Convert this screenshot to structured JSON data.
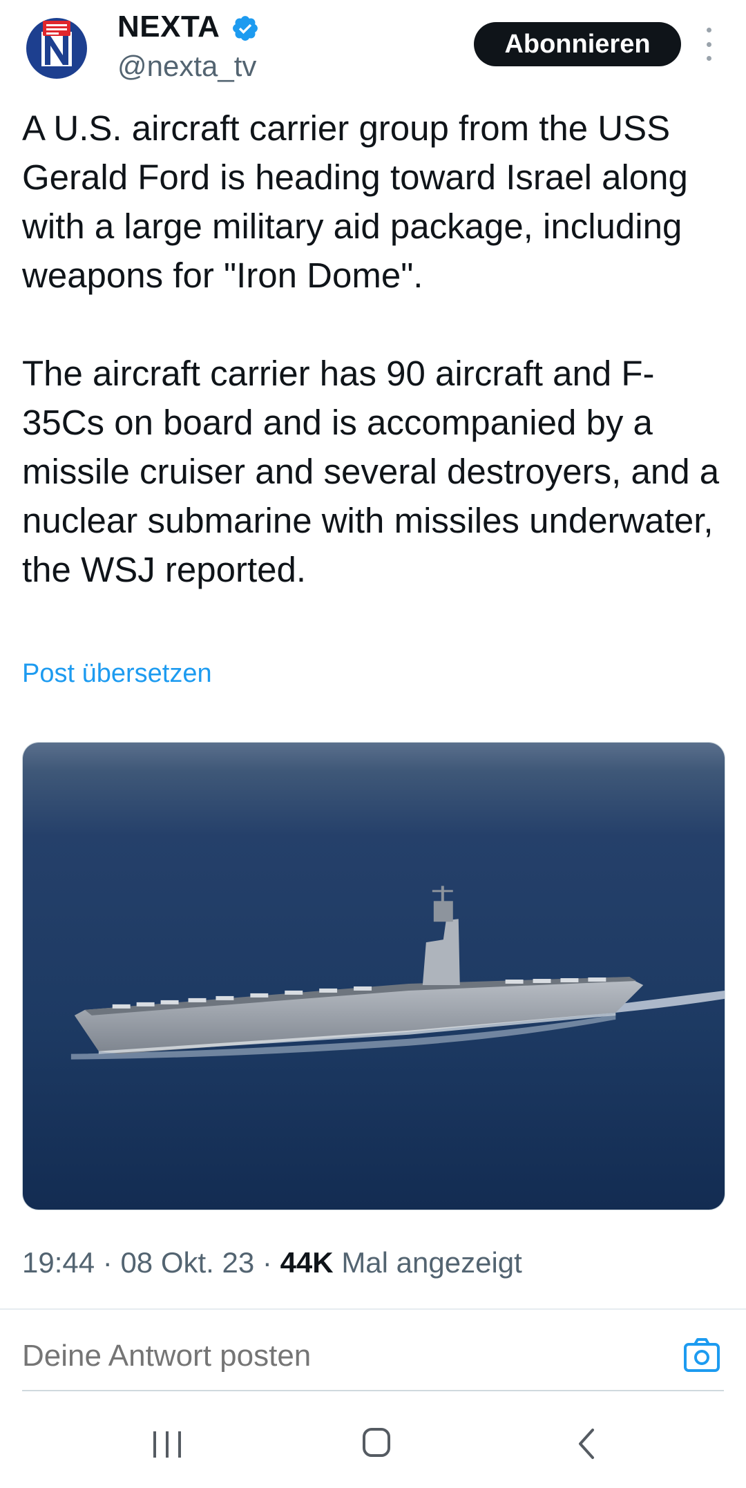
{
  "account": {
    "display_name": "NEXTA",
    "handle": "@nexta_tv",
    "verified": true,
    "avatar_icon": "nexta-logo-icon"
  },
  "header": {
    "subscribe_label": "Abonnieren",
    "more_icon": "vertical-dots-icon"
  },
  "tweet": {
    "paragraphs": [
      "A U.S. aircraft carrier group from the USS Gerald Ford is heading toward Israel along with a large military aid package, including weapons for \"Iron Dome\".",
      "The aircraft carrier has 90 aircraft and F-35Cs on board and is accompanied by a missile cruiser and several destroyers, and a nuclear submarine with missiles underwater, the WSJ reported."
    ],
    "translate_label": "Post übersetzen",
    "media_icon": "aircraft-carrier-photo"
  },
  "meta": {
    "time": "19:44",
    "separator": "·",
    "date": "08 Okt. 23",
    "views_count": "44K",
    "views_label": "Mal angezeigt"
  },
  "reply": {
    "placeholder": "Deine Antwort posten",
    "camera_icon": "camera-icon"
  },
  "navbar": {
    "recents_icon": "recents-icon",
    "home_icon": "home-icon",
    "back_icon": "back-icon"
  },
  "colors": {
    "text": "#0f1419",
    "secondary": "#536471",
    "link": "#1d9bf0",
    "verified": "#1d9bf0",
    "button_bg": "#0f1419"
  }
}
